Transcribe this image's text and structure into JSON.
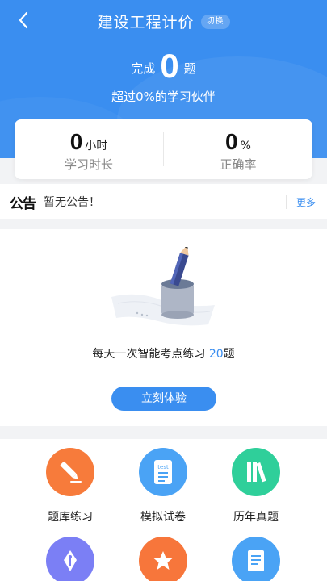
{
  "header": {
    "title": "建设工程计价",
    "switch_label": "切换",
    "done_prefix": "完成",
    "done_count": "0",
    "done_suffix": "题",
    "subtitle": "超过0%的学习伙伴"
  },
  "stats": [
    {
      "value": "0",
      "unit": "小时",
      "label": "学习时长"
    },
    {
      "value": "0",
      "unit": "%",
      "label": "正确率"
    }
  ],
  "notice": {
    "badge": "公告",
    "message": "暂无公告！",
    "more": "更多"
  },
  "practice": {
    "desc_prefix": "每天一次智能考点练习",
    "desc_count": "20",
    "desc_suffix": "题",
    "button": "立刻体验"
  },
  "menu": [
    {
      "label": "题库练习",
      "icon": "pencil-icon",
      "color": "#f77b3b"
    },
    {
      "label": "模拟试卷",
      "icon": "test-paper-icon",
      "color": "#4aa3f5"
    },
    {
      "label": "历年真题",
      "icon": "books-icon",
      "color": "#2fcf9a"
    },
    {
      "label": "",
      "icon": "pen-nib-icon",
      "color": "#7b7ff5"
    },
    {
      "label": "",
      "icon": "star-icon",
      "color": "#f7763b"
    },
    {
      "label": "",
      "icon": "document-icon",
      "color": "#4aa3f5"
    }
  ],
  "colors": {
    "primary": "#3a8ef0"
  }
}
